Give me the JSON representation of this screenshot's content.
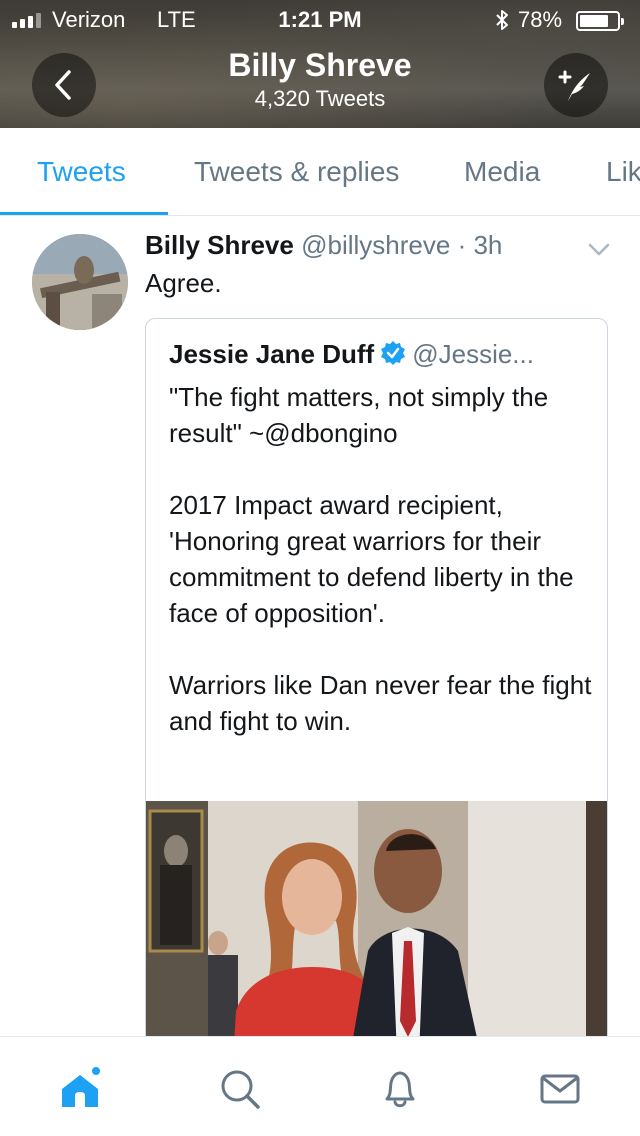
{
  "status_bar": {
    "carrier": "Verizon",
    "network": "LTE",
    "time": "1:21 PM",
    "battery": "78%",
    "battery_level": 0.78
  },
  "header": {
    "title": "Billy Shreve",
    "subtitle": "4,320 Tweets",
    "back_icon": "chevron-left-icon",
    "compose_icon": "compose-feather-icon"
  },
  "tabs": [
    {
      "label": "Tweets",
      "active": true
    },
    {
      "label": "Tweets & replies",
      "active": false
    },
    {
      "label": "Media",
      "active": false
    },
    {
      "label": "Lik",
      "active": false
    }
  ],
  "tweet": {
    "name": "Billy Shreve",
    "handle": "@billyshreve",
    "separator": "·",
    "age": "3h",
    "text": "Agree.",
    "quoted": {
      "name": "Jessie Jane Duff",
      "handle": "@Jessie...",
      "verified": true,
      "paragraphs": [
        "\"The fight matters, not simply the result\" ~@dbongino",
        "2017 Impact award recipient, 'Honoring great warriors for their commitment to defend liberty in the face of opposition'.",
        "Warriors like Dan never fear the fight and fight  to win."
      ]
    }
  },
  "bottom_nav": {
    "items": [
      "home-icon",
      "search-icon",
      "notifications-bell-icon",
      "messages-envelope-icon"
    ],
    "accent": "#1da1f2",
    "inactive": "#657786"
  },
  "colors": {
    "accent": "#1da1f2",
    "secondary_text": "#657786",
    "primary_text": "#14171a",
    "border": "#e1e8ed"
  }
}
